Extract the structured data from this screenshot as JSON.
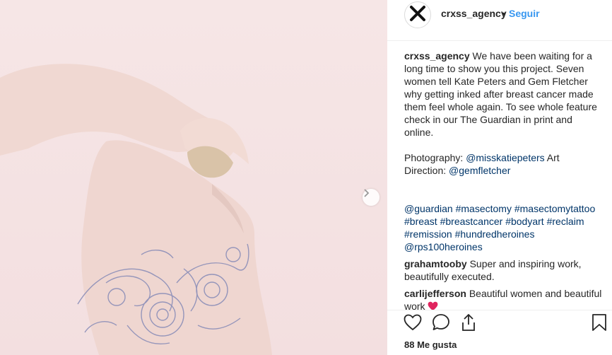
{
  "post": {
    "username": "crxss_agency",
    "separator": "•",
    "follow_label": "Seguir",
    "caption": {
      "author": "crxss_agency",
      "text": "We have been waiting for a long time to show you this project. Seven women tell Kate Peters and Gem Fletcher why getting inked after breast cancer made them feel whole again. To see whole feature check in our The Guardian in print and online.",
      "credits_photo_label": "Photography:",
      "credits_photo_handle": "@misskatiepeters",
      "credits_art_label": "Art Direction:",
      "credits_art_handle": "@gemfletcher",
      "tags": [
        "@guardian",
        "#masectomy",
        "#masectomytattoo",
        "#breast",
        "#breastcancer",
        "#bodyart",
        "#reclaim",
        "#remission",
        "#hundredheroines",
        "@rps100heroines"
      ]
    },
    "comments": [
      {
        "author": "grahamtooby",
        "text": "Super and inspiring work, beautifully executed."
      },
      {
        "author": "carlijefferson",
        "text": "Beautiful women and beautiful work"
      }
    ],
    "likes_label": "88 Me gusta"
  },
  "icons": {
    "avatar": "x-logo-icon",
    "next": "chevron-right-icon",
    "like": "heart-icon",
    "comment": "comment-icon",
    "share": "share-icon",
    "save": "bookmark-icon"
  },
  "colors": {
    "link": "#003569",
    "follow": "#3897f0",
    "heart_emoji": "#e0245e"
  }
}
